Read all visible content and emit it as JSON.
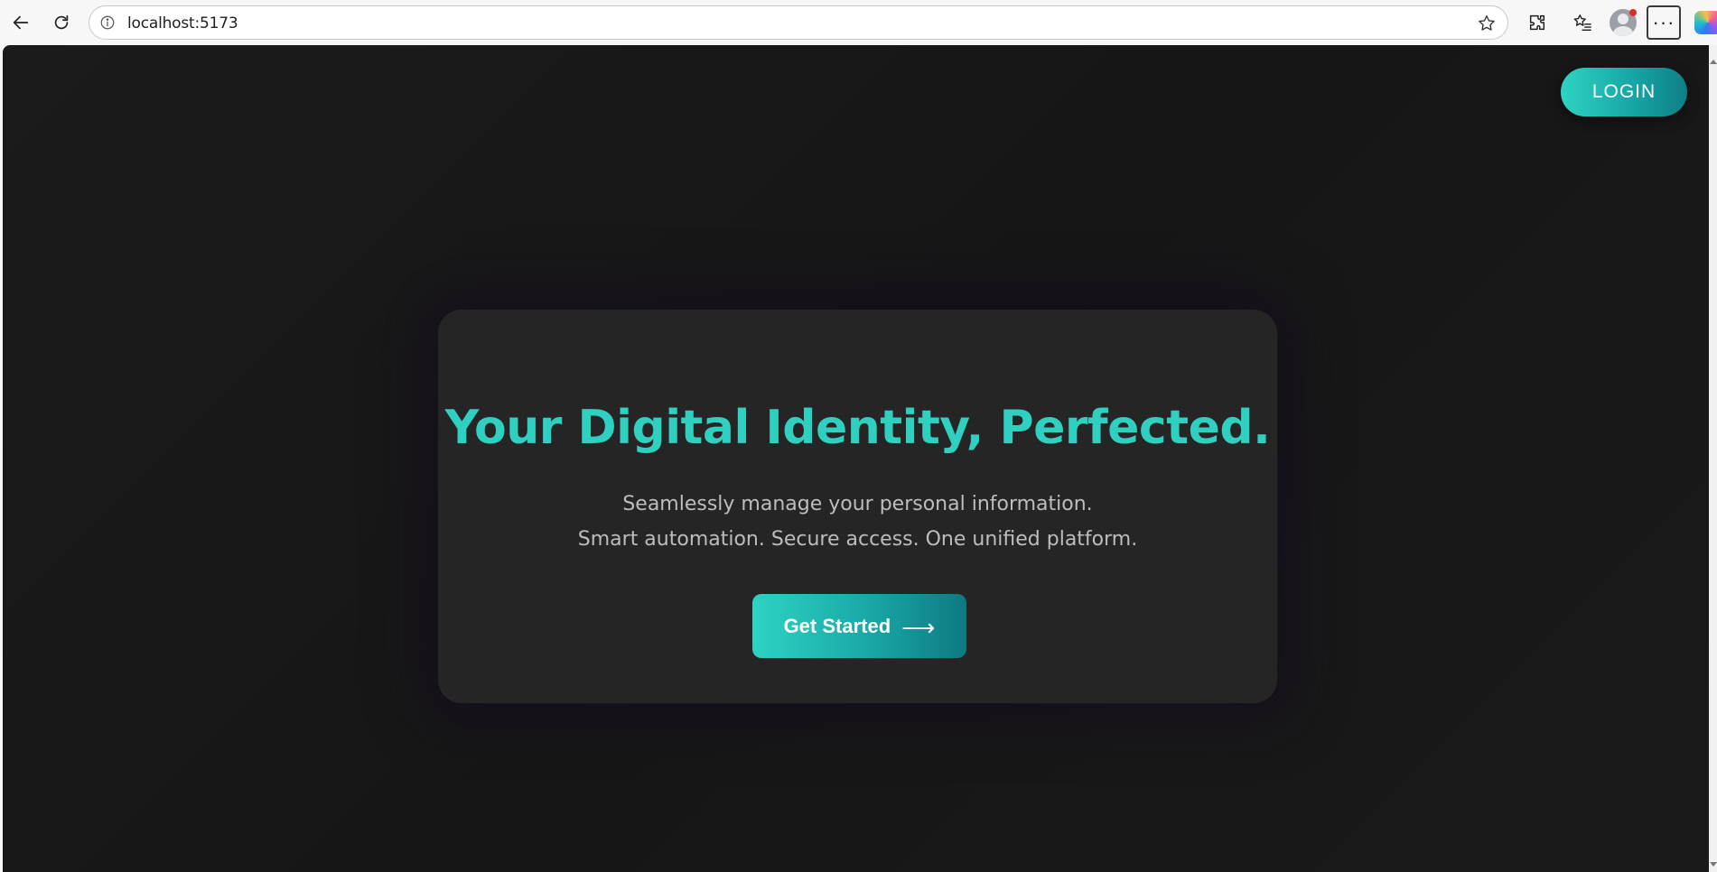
{
  "browser": {
    "url": "localhost:5173",
    "icons": {
      "back": "back-arrow-icon",
      "reload": "reload-icon",
      "site_info": "info-icon",
      "favorite": "star-icon",
      "extensions": "puzzle-icon",
      "favorites": "favorites-list-icon",
      "profile": "avatar",
      "more": "ellipsis-icon",
      "copilot": "copilot-icon"
    },
    "more_label": "···"
  },
  "page": {
    "login_label": "LOGIN",
    "hero": {
      "title": "Your Digital Identity, Perfected.",
      "subtitle_line1": "Seamlessly manage your personal information.",
      "subtitle_line2": "Smart automation. Secure access. One unified platform.",
      "cta_label": "Get Started",
      "cta_arrow": "⟶"
    }
  },
  "colors": {
    "accent": "#2fd0c0",
    "accent_dark": "#0e7f86",
    "background": "#1a1a1a",
    "card": "#252525",
    "subtitle_text": "#bdbdbd"
  }
}
